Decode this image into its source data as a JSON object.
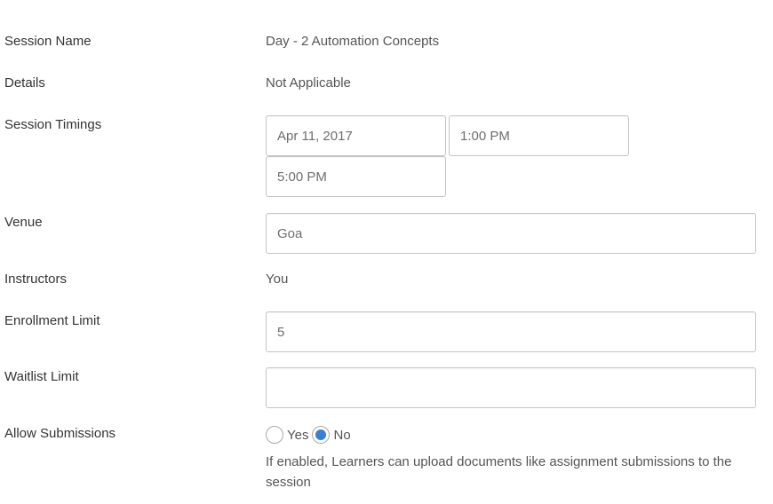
{
  "form": {
    "session_name": {
      "label": "Session Name",
      "value": "Day - 2 Automation Concepts"
    },
    "details": {
      "label": "Details",
      "value": "Not Applicable"
    },
    "session_timings": {
      "label": "Session Timings",
      "date": "Apr 11, 2017",
      "start_time": "1:00 PM",
      "end_time": "5:00 PM"
    },
    "venue": {
      "label": "Venue",
      "value": "Goa"
    },
    "instructors": {
      "label": "Instructors",
      "value": "You"
    },
    "enrollment_limit": {
      "label": "Enrollment Limit",
      "value": "5"
    },
    "waitlist_limit": {
      "label": "Waitlist Limit",
      "value": ""
    },
    "allow_submissions": {
      "label": "Allow Submissions",
      "options": [
        {
          "label": "Yes",
          "selected": false
        },
        {
          "label": "No",
          "selected": true
        }
      ],
      "help_text": "If enabled, Learners can upload documents like assignment submissions to the session"
    }
  },
  "colors": {
    "radio_selected": "#3a7fd5"
  }
}
